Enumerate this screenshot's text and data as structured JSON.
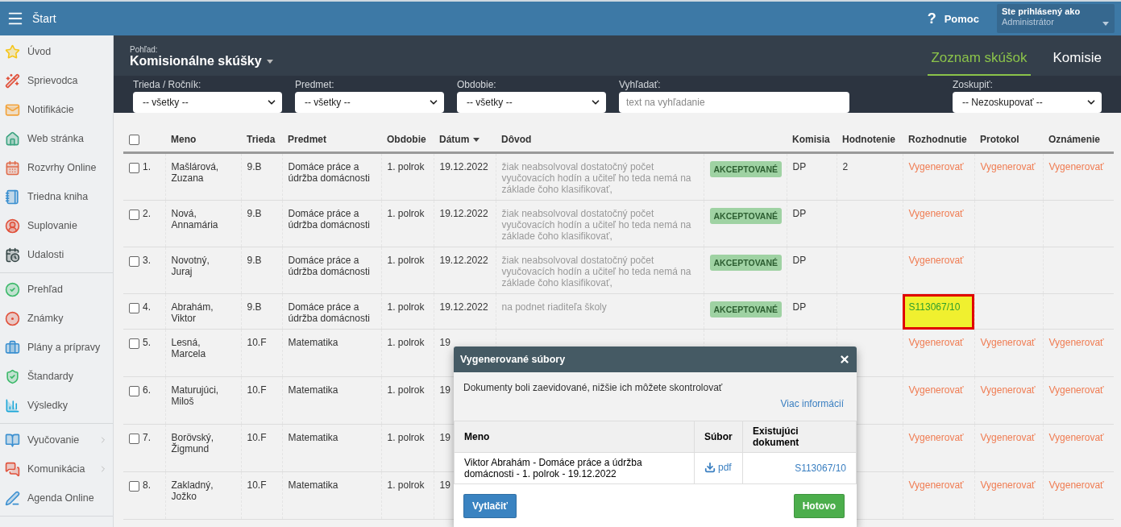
{
  "topbar": {
    "title": "Štart",
    "help_icon": "?",
    "help": "Pomoc",
    "user_label": "Ste prihlásený ako",
    "user_name": "Administrátor"
  },
  "sidebar": {
    "groups": [
      [
        {
          "label": "Úvod",
          "submenu": false
        },
        {
          "label": "Sprievodca",
          "submenu": false
        },
        {
          "label": "Notifikácie",
          "submenu": false
        },
        {
          "label": "Web stránka",
          "submenu": false
        },
        {
          "label": "Rozvrhy Online",
          "submenu": false
        },
        {
          "label": "Triedna kniha",
          "submenu": false
        },
        {
          "label": "Suplovanie",
          "submenu": false
        },
        {
          "label": "Udalosti",
          "submenu": false
        }
      ],
      [
        {
          "label": "Prehľad",
          "submenu": false
        },
        {
          "label": "Známky",
          "submenu": false
        },
        {
          "label": "Plány a prípravy",
          "submenu": false
        },
        {
          "label": "Štandardy",
          "submenu": false
        },
        {
          "label": "Výsledky",
          "submenu": false
        }
      ],
      [
        {
          "label": "Vyučovanie",
          "submenu": true
        },
        {
          "label": "Komunikácia",
          "submenu": true
        },
        {
          "label": "Agenda Online",
          "submenu": false
        }
      ]
    ]
  },
  "view": {
    "label": "Pohľad:",
    "title": "Komisionálne skúšky"
  },
  "tabs": [
    {
      "label": "Zoznam skúšok",
      "selected": true
    },
    {
      "label": "Komisie",
      "selected": false
    }
  ],
  "filters": [
    {
      "kind": "select",
      "label": "Trieda / Ročník:",
      "value": "-- všetky --"
    },
    {
      "kind": "select",
      "label": "Predmet:",
      "value": "-- všetky --"
    },
    {
      "kind": "select",
      "label": "Obdobie:",
      "value": "-- všetky --"
    },
    {
      "kind": "search",
      "label": "Vyhľadať:",
      "placeholder": "text na vyhľadanie"
    },
    {
      "kind": "spacer"
    },
    {
      "kind": "select",
      "label": "Zoskupiť:",
      "value": "-- Nezoskupovať --"
    }
  ],
  "table": {
    "select_all_checked": false,
    "columns": [
      {
        "label": "Meno",
        "sorted": false
      },
      {
        "label": "Trieda",
        "sorted": false
      },
      {
        "label": "Predmet",
        "sorted": false
      },
      {
        "label": "Obdobie",
        "sorted": false
      },
      {
        "label": "Dátum",
        "sorted": true
      },
      {
        "label": "Dôvod",
        "sorted": false
      },
      {
        "sorted": false
      },
      {
        "label": "Komisia",
        "sorted": false
      },
      {
        "label": "Hodnotenie",
        "sorted": false
      },
      {
        "label": "Rozhodnutie",
        "sorted": false
      },
      {
        "label": "Protokol",
        "sorted": false
      },
      {
        "label": "Oznámenie",
        "sorted": false
      }
    ],
    "rows": [
      {
        "index": "1.",
        "checked": false,
        "name": "Mašlárová, Zuzana",
        "class": "9.B",
        "subject": "Domáce práce a údržba domácnosti",
        "period": "1. polrok",
        "date": "19.12.2022",
        "reason": "žiak neabsolvoval dostatočný počet vyučovacích hodín a učiteľ ho teda nemá na základe čoho klasifikovať,",
        "status": "AKCEPTOVANÉ",
        "commission": "DP",
        "grade": "2",
        "decision": {
          "kind": "generate",
          "text": "Vygenerovať",
          "highlighted": false
        },
        "protocol": "Vygenerovať",
        "notice": "Vygenerovať"
      },
      {
        "index": "2.",
        "checked": false,
        "name": "Nová, Annamária",
        "class": "9.B",
        "subject": "Domáce práce a údržba domácnosti",
        "period": "1. polrok",
        "date": "19.12.2022",
        "reason": "žiak neabsolvoval dostatočný počet vyučovacích hodín a učiteľ ho teda nemá na základe čoho klasifikovať,",
        "status": "AKCEPTOVANÉ",
        "commission": "DP",
        "decision": {
          "kind": "generate",
          "text": "Vygenerovať",
          "highlighted": false
        }
      },
      {
        "index": "3.",
        "checked": false,
        "name": "Novotný, Juraj",
        "class": "9.B",
        "subject": "Domáce práce a údržba domácnosti",
        "period": "1. polrok",
        "date": "19.12.2022",
        "reason": "žiak neabsolvoval dostatočný počet vyučovacích hodín a učiteľ ho teda nemá na základe čoho klasifikovať,",
        "status": "AKCEPTOVANÉ",
        "commission": "DP",
        "decision": {
          "kind": "generate",
          "text": "Vygenerovať",
          "highlighted": false
        }
      },
      {
        "index": "4.",
        "checked": false,
        "name": "Abrahám, Viktor",
        "class": "9.B",
        "subject": "Domáce práce a údržba domácnosti",
        "period": "1. polrok",
        "date": "19.12.2022",
        "reason": "na podnet riaditeľa školy",
        "status": "AKCEPTOVANÉ",
        "commission": "DP",
        "decision": {
          "kind": "document",
          "text": "S113067/10",
          "highlighted": true
        }
      },
      {
        "index": "5.",
        "checked": false,
        "name": "Lesná, Marcela",
        "class": "10.F",
        "subject": "Matematika",
        "period": "1. polrok",
        "date": "19",
        "decision": {
          "kind": "generate",
          "text": "Vygenerovať",
          "highlighted": false
        },
        "protocol": "Vygenerovať",
        "notice": "Vygenerovať"
      },
      {
        "index": "6.",
        "checked": false,
        "name": "Maturujúci, Miloš",
        "class": "10.F",
        "subject": "Matematika",
        "period": "1. polrok",
        "date": "19",
        "decision": {
          "kind": "generate",
          "text": "Vygenerovať",
          "highlighted": false
        },
        "protocol": "Vygenerovať",
        "notice": "Vygenerovať"
      },
      {
        "index": "7.",
        "checked": false,
        "name": "Borövský, Žigmund",
        "class": "10.F",
        "subject": "Matematika",
        "period": "1. polrok",
        "date": "19",
        "decision": {
          "kind": "generate",
          "text": "Vygenerovať",
          "highlighted": false
        },
        "protocol": "Vygenerovať",
        "notice": "Vygenerovať"
      },
      {
        "index": "8.",
        "checked": false,
        "name": "Zakladný, Jožko",
        "class": "10.F",
        "subject": "Matematika",
        "period": "1. polrok",
        "date": "19",
        "decision": {
          "kind": "generate",
          "text": "Vygenerovať",
          "highlighted": false
        },
        "protocol": "Vygenerovať",
        "notice": "Vygenerovať"
      }
    ]
  },
  "modal": {
    "title": "Vygenerované súbory",
    "message": "Dokumenty boli zaevidované, nižšie ich môžete skontrolovať",
    "more_link": "Viac informácií",
    "columns": [
      "Meno",
      "Súbor",
      "Existujúci dokument"
    ],
    "rows": [
      {
        "name": "Viktor Abrahám - Domáce práce a údržba domácnosti - 1. polrok - 19.12.2022",
        "file": "pdf",
        "document": "S113067/10"
      }
    ],
    "print_button": "Vytlačiť",
    "done_button": "Hotovo"
  }
}
